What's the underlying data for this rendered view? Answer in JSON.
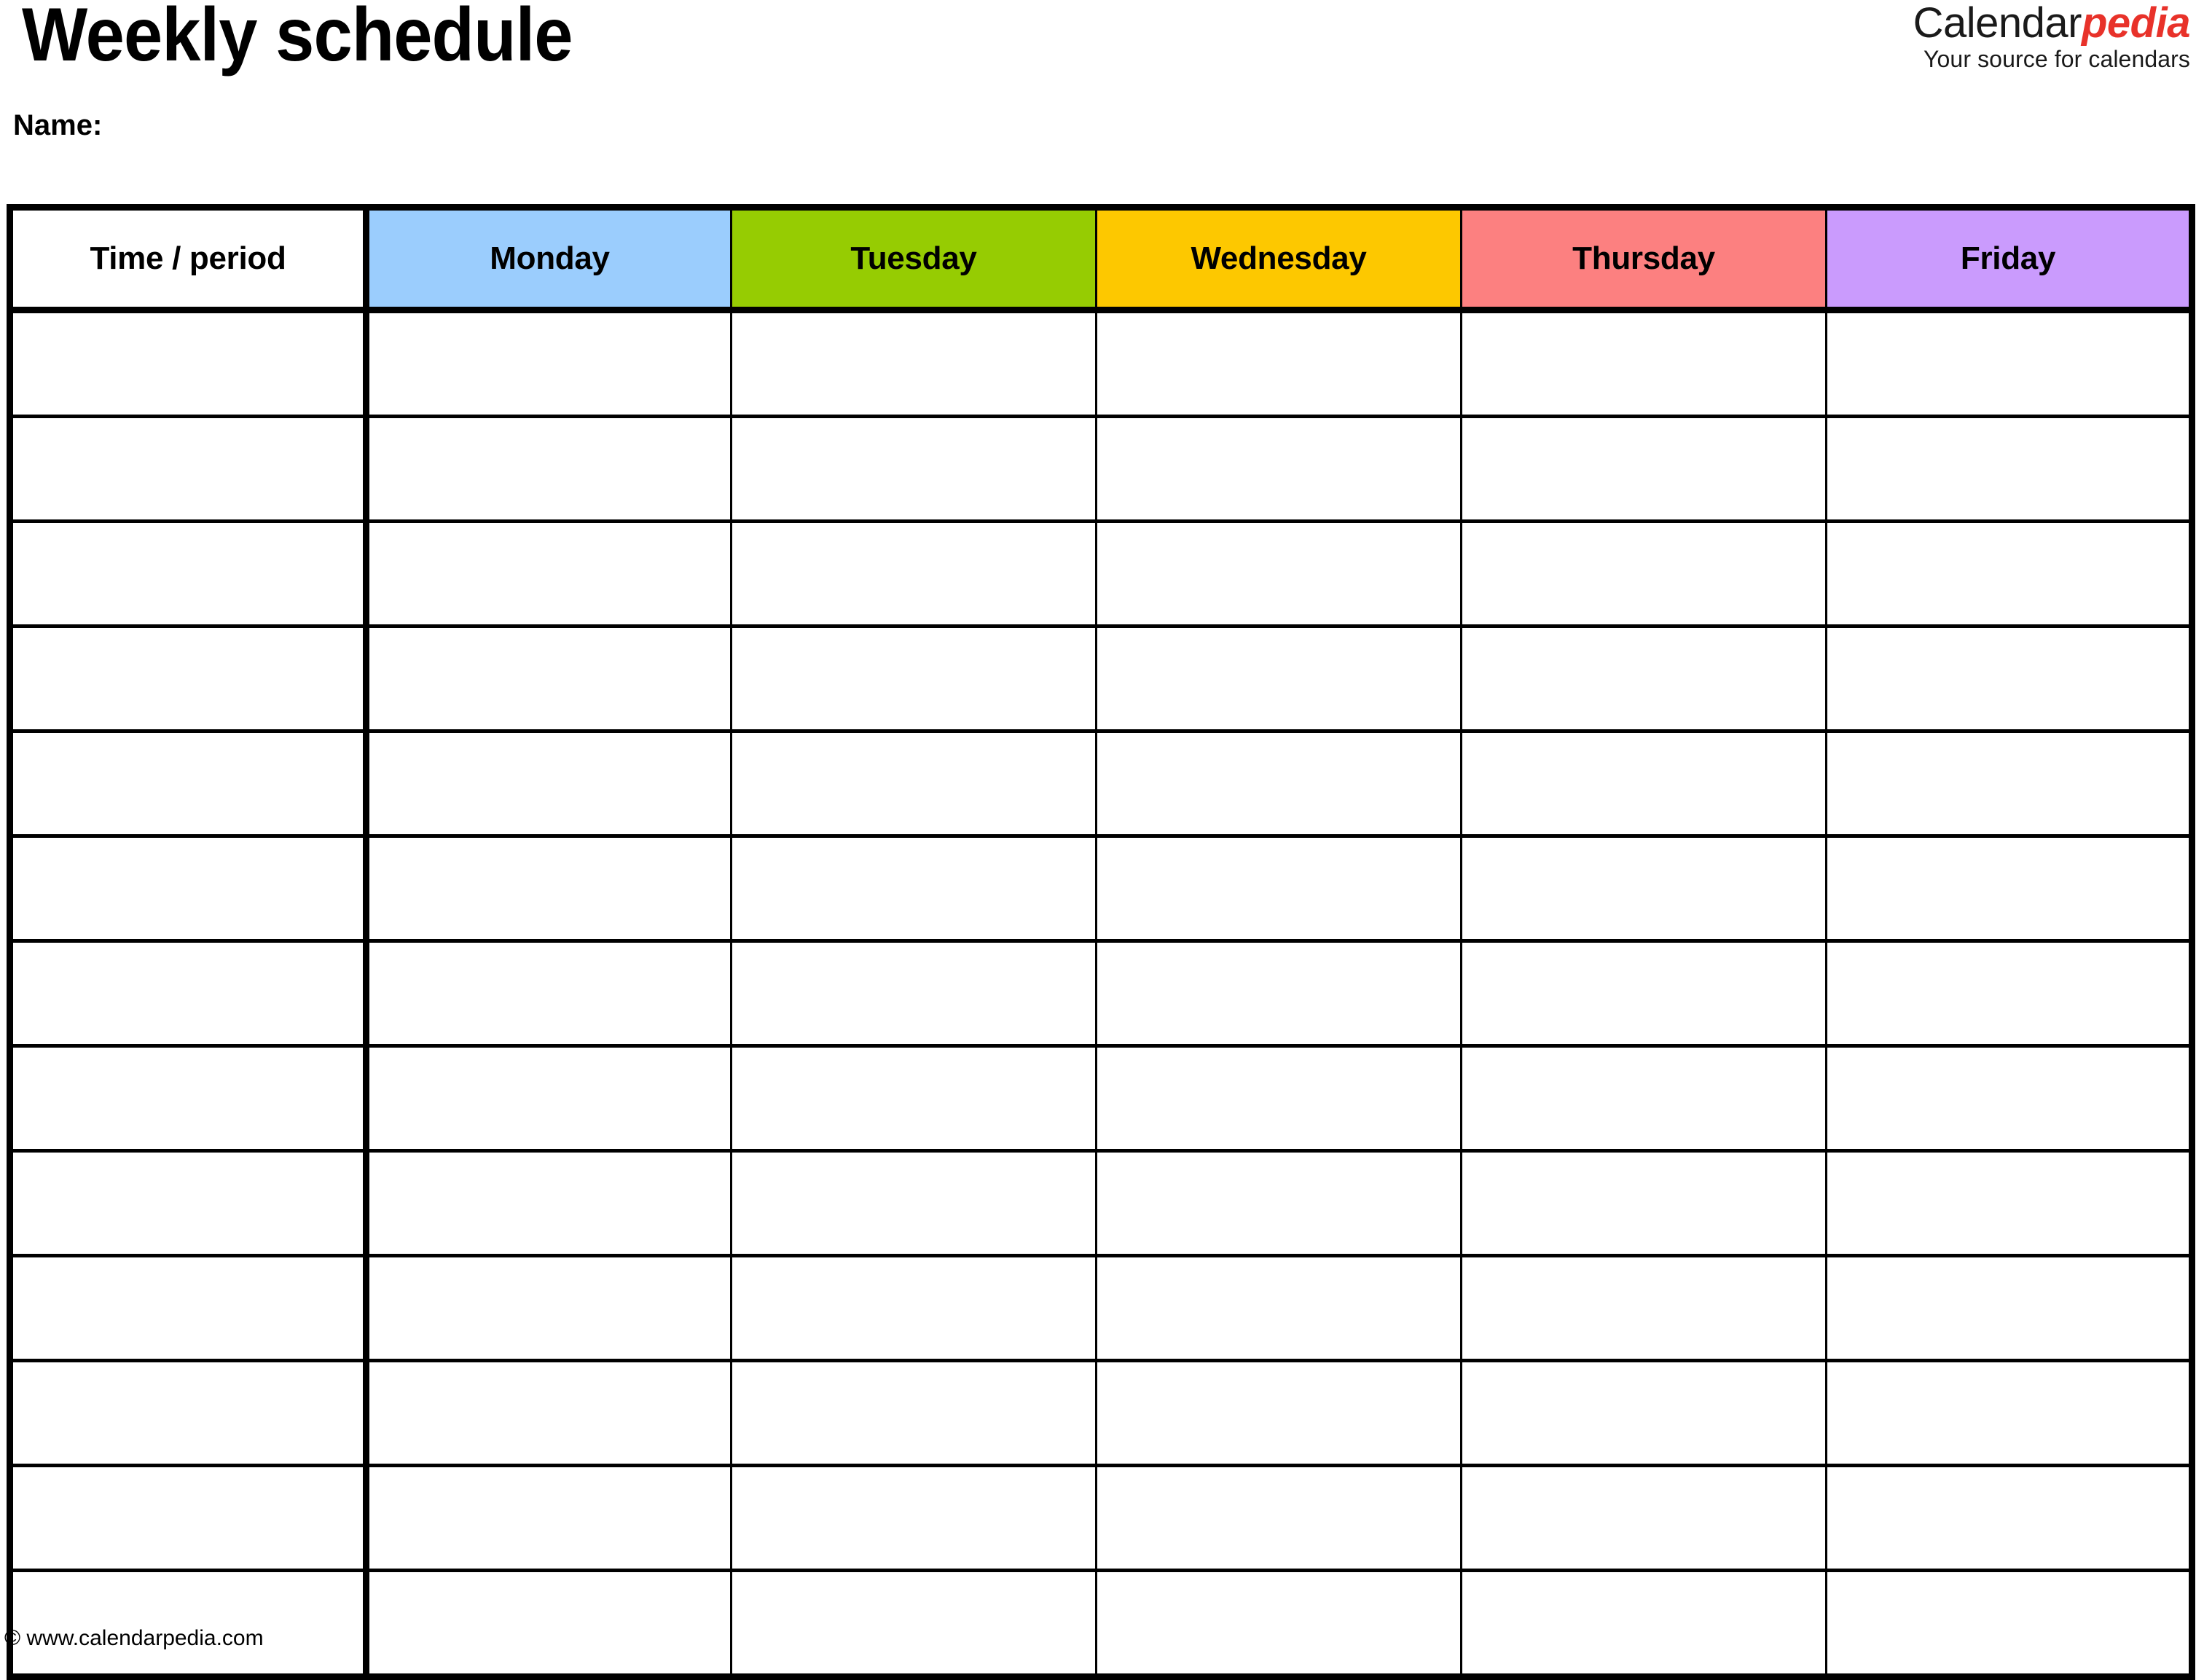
{
  "document": {
    "title": "Weekly schedule",
    "name_label": "Name:",
    "footer_credit": "© www.calendarpedia.com"
  },
  "brand": {
    "word_part_1": "Calendar",
    "word_part_2": "pedia",
    "tagline": "Your source for calendars",
    "accent_color": "#e8322a"
  },
  "table": {
    "columns": [
      {
        "label": "Time / period",
        "bg": "#ffffff"
      },
      {
        "label": "Monday",
        "bg": "#9bcdfd"
      },
      {
        "label": "Tuesday",
        "bg": "#96cc02"
      },
      {
        "label": "Wednesday",
        "bg": "#fdc800"
      },
      {
        "label": "Thursday",
        "bg": "#fc8080"
      },
      {
        "label": "Friday",
        "bg": "#ca9bfd"
      }
    ],
    "row_count": 13,
    "rows": [
      [
        "",
        "",
        "",
        "",
        "",
        ""
      ],
      [
        "",
        "",
        "",
        "",
        "",
        ""
      ],
      [
        "",
        "",
        "",
        "",
        "",
        ""
      ],
      [
        "",
        "",
        "",
        "",
        "",
        ""
      ],
      [
        "",
        "",
        "",
        "",
        "",
        ""
      ],
      [
        "",
        "",
        "",
        "",
        "",
        ""
      ],
      [
        "",
        "",
        "",
        "",
        "",
        ""
      ],
      [
        "",
        "",
        "",
        "",
        "",
        ""
      ],
      [
        "",
        "",
        "",
        "",
        "",
        ""
      ],
      [
        "",
        "",
        "",
        "",
        "",
        ""
      ],
      [
        "",
        "",
        "",
        "",
        "",
        ""
      ],
      [
        "",
        "",
        "",
        "",
        "",
        ""
      ],
      [
        "",
        "",
        "",
        "",
        "",
        ""
      ]
    ]
  }
}
